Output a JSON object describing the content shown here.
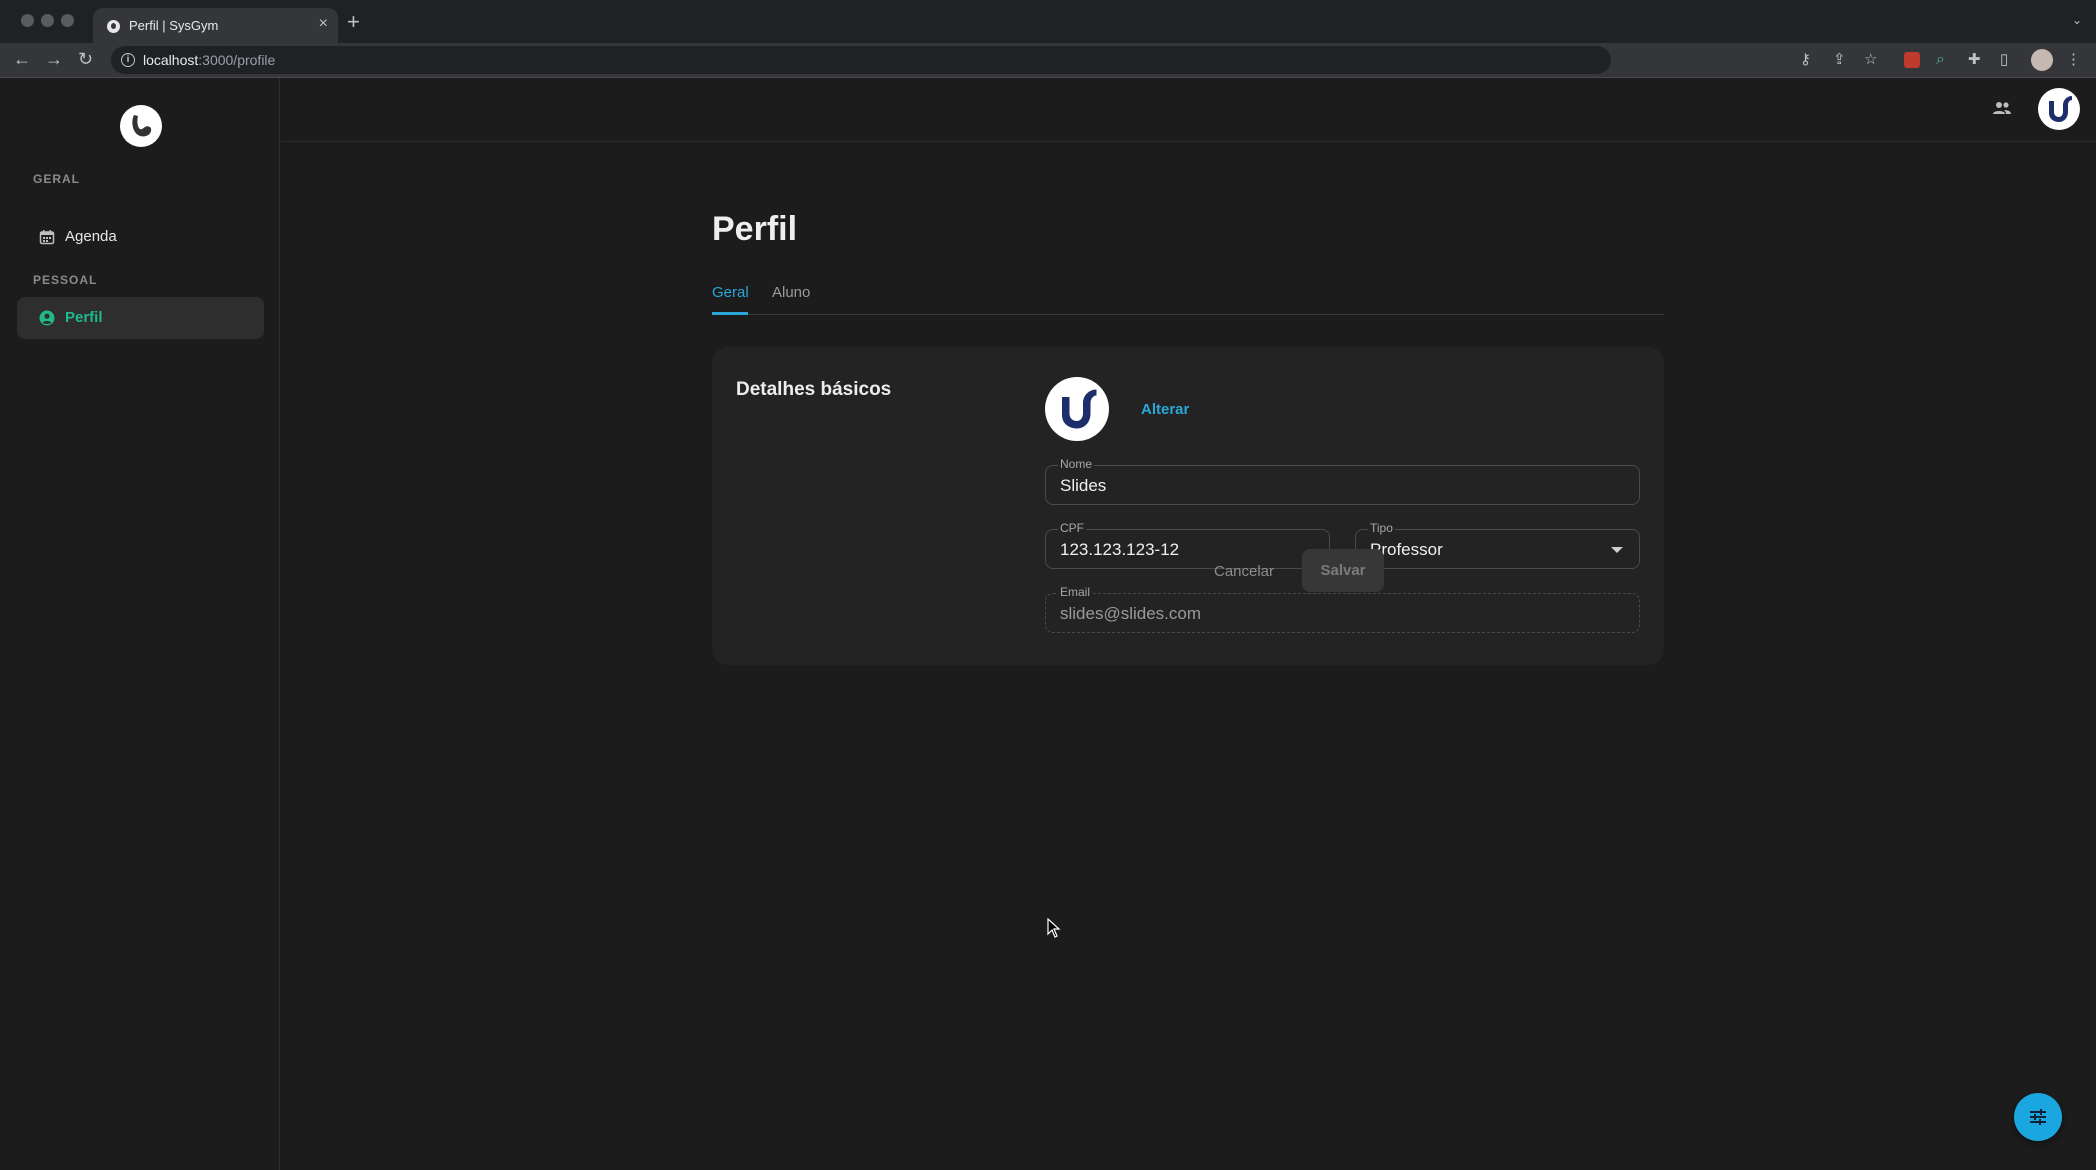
{
  "browser": {
    "tab_title": "Perfil | SysGym",
    "tab_close": "×",
    "new_tab": "+",
    "url_host": "localhost",
    "url_path": ":3000/profile",
    "info_glyph": "i"
  },
  "sidebar": {
    "sections": [
      {
        "label": "GERAL",
        "items": [
          {
            "label": "Agenda",
            "icon": "calendar-icon",
            "active": false
          }
        ]
      },
      {
        "label": "PESSOAL",
        "items": [
          {
            "label": "Perfil",
            "icon": "user-circle-icon",
            "active": true
          }
        ]
      }
    ]
  },
  "page": {
    "title": "Perfil",
    "tabs": [
      {
        "label": "Geral",
        "active": true
      },
      {
        "label": "Aluno",
        "active": false
      }
    ]
  },
  "card": {
    "title": "Detalhes básicos",
    "change_label": "Alterar",
    "fields": {
      "nome": {
        "label": "Nome",
        "value": "Slides"
      },
      "cpf": {
        "label": "CPF",
        "value": "123.123.123-12"
      },
      "tipo": {
        "label": "Tipo",
        "value": "Professor"
      },
      "email": {
        "label": "Email",
        "value": "slides@slides.com"
      }
    }
  },
  "actions": {
    "cancel_label": "Cancelar",
    "save_label": "Salvar"
  },
  "colors": {
    "accent": "#2aa6d8",
    "active_nav": "#21b88a",
    "fab": "#1aa7e0",
    "background": "#1c1c1c",
    "card": "#232323"
  }
}
